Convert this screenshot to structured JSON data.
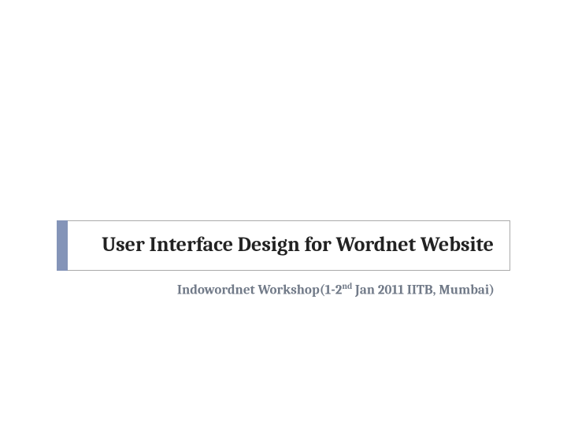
{
  "slide": {
    "title": "User Interface Design for Wordnet Website",
    "subtitle_prefix": "Indowordnet Workshop(1-2",
    "subtitle_super": "nd",
    "subtitle_suffix": " Jan 2011 IITB, Mumbai)",
    "accent_color": "#8494b8"
  }
}
